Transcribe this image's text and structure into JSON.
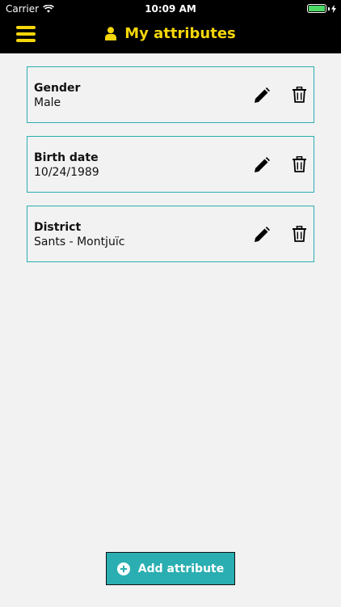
{
  "status_bar": {
    "carrier": "Carrier",
    "time": "10:09 AM",
    "battery_color": "#4cd964"
  },
  "header": {
    "title": "My attributes",
    "title_icon": "user-icon",
    "menu_icon": "hamburger-menu-icon",
    "accent_color": "#f5d60a"
  },
  "attributes": [
    {
      "label": "Gender",
      "value": "Male"
    },
    {
      "label": "Birth date",
      "value": "10/24/1989"
    },
    {
      "label": "District",
      "value": "Sants - Montjuïc"
    }
  ],
  "card_actions": {
    "edit_icon": "pencil-icon",
    "delete_icon": "trash-icon"
  },
  "footer": {
    "add_button_label": "Add attribute",
    "add_button_icon": "plus-circle-icon",
    "button_color": "#2aaeb1"
  }
}
